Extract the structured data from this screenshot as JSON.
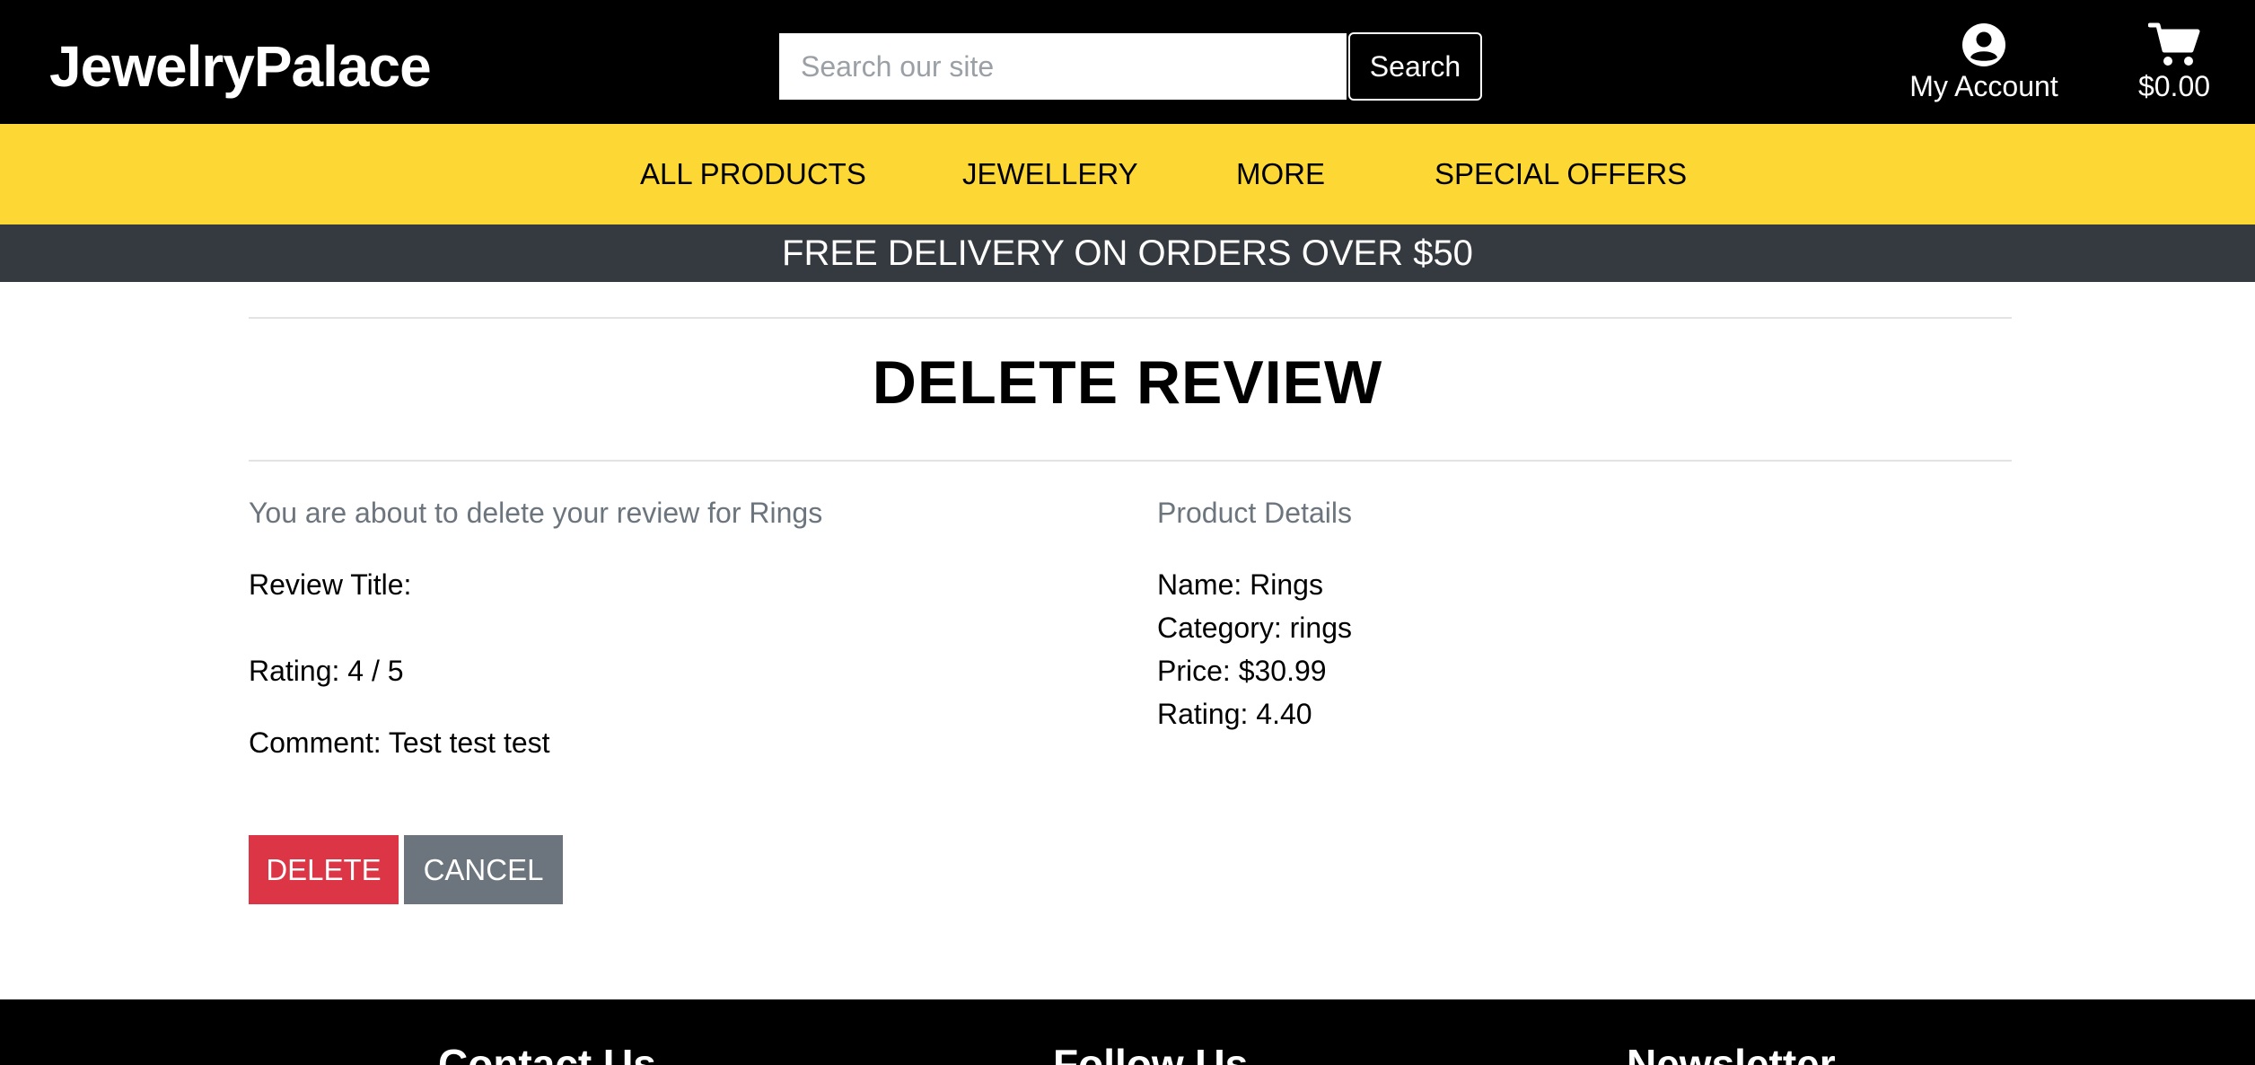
{
  "header": {
    "logo": "JewelryPalace",
    "search_placeholder": "Search our site",
    "search_button": "Search",
    "account_label": "My Account",
    "cart_total": "$0.00"
  },
  "nav": {
    "items": [
      "ALL PRODUCTS",
      "JEWELLERY",
      "MORE",
      "SPECIAL OFFERS"
    ]
  },
  "promo": {
    "text": "FREE DELIVERY ON ORDERS OVER $50"
  },
  "main": {
    "title": "DELETE REVIEW",
    "intro": "You are about to delete your review for Rings",
    "review_title_label": "Review Title:",
    "rating_line": "Rating: 4 / 5",
    "comment_line": "Comment: Test test test",
    "delete_button": "DELETE",
    "cancel_button": "CANCEL"
  },
  "product": {
    "heading": "Product Details",
    "name_line": "Name: Rings",
    "category_line": "Category: rings",
    "price_line": "Price: $30.99",
    "rating_line": "Rating: 4.40"
  },
  "footer": {
    "contact_heading": "Contact Us",
    "follow_heading": "Follow Us",
    "newsletter_heading": "Newsletter"
  },
  "colors": {
    "header_bg": "#000000",
    "nav_bg": "#fdd835",
    "promo_bg": "#343a40",
    "delete_bg": "#dc3545",
    "cancel_bg": "#6c757d"
  },
  "icons": {
    "account": "user-circle-icon",
    "cart": "shopping-cart-icon"
  }
}
